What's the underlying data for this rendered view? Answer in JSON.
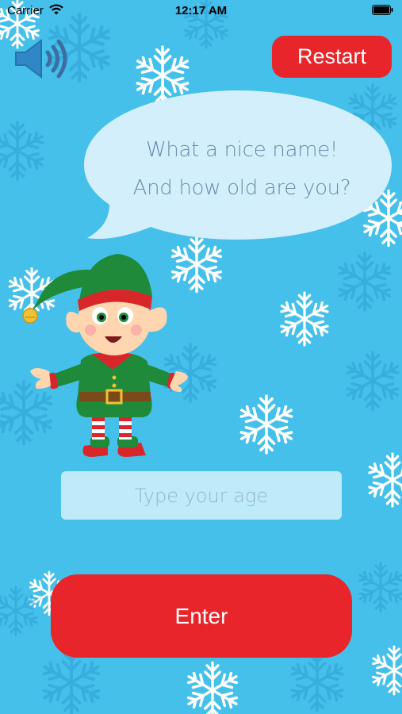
{
  "status_bar": {
    "carrier": "Carrier",
    "time": "12:17 AM"
  },
  "header": {
    "restart_label": "Restart"
  },
  "speech_bubble": {
    "line1": "What a nice name!",
    "line2": "And how old are you?"
  },
  "age_form": {
    "placeholder": "Type your age",
    "value": "",
    "enter_label": "Enter"
  },
  "colors": {
    "background": "#45c0ea",
    "button": "#e8252a",
    "bubble": "#d3effb",
    "input": "#bfeaf9",
    "bubble_text": "#6a8bb1"
  },
  "icons": {
    "sound": "speaker-sound-on-icon",
    "wifi": "wifi-icon",
    "battery": "battery-icon"
  }
}
